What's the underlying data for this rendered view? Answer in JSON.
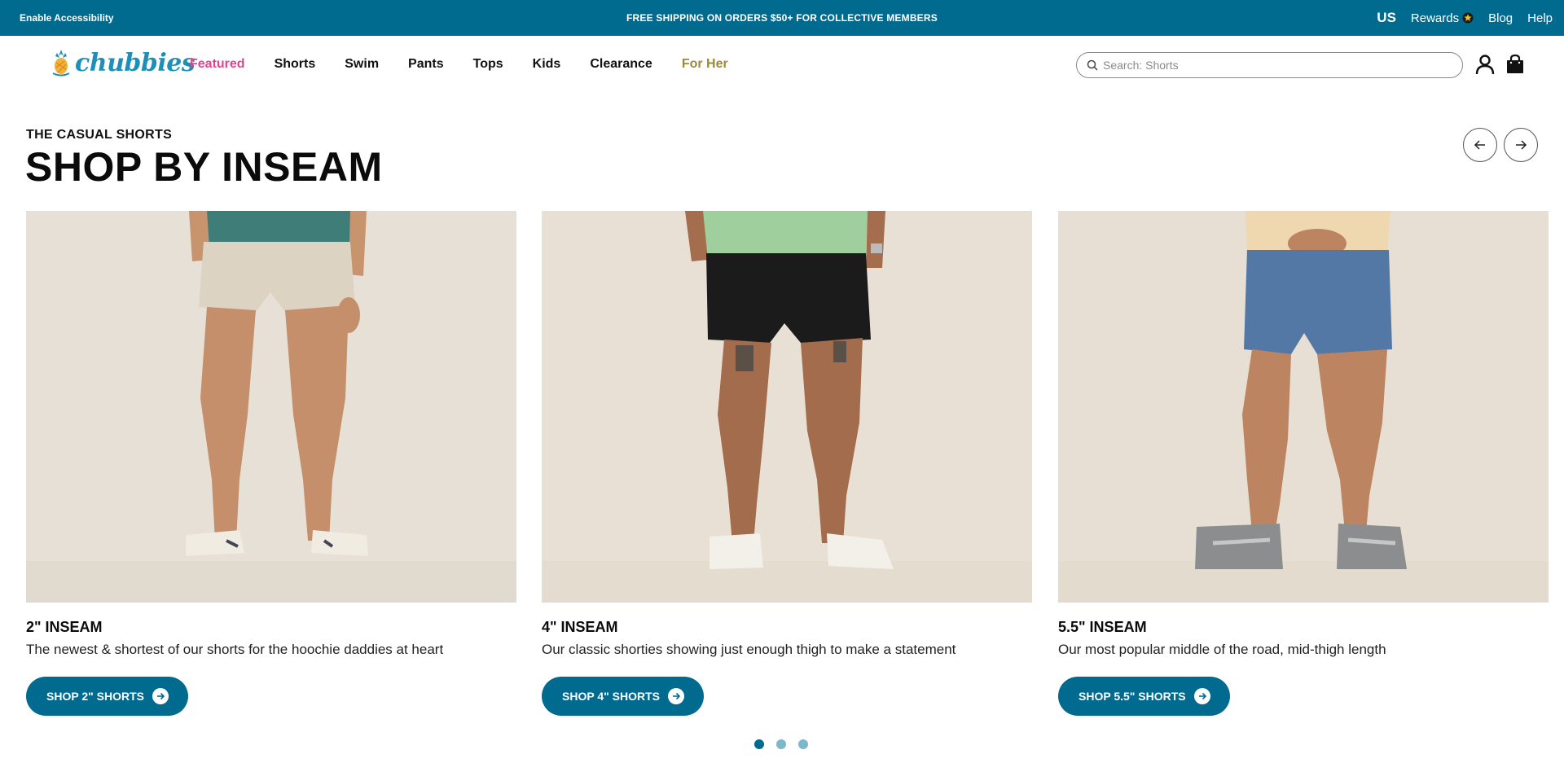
{
  "colors": {
    "brand": "#006b8f",
    "featured": "#e0458c",
    "for_her": "#9a8a3c",
    "logo": "#1d8fb8"
  },
  "topbar": {
    "accessibility": "Enable Accessibility",
    "promo": "FREE SHIPPING ON ORDERS $50+ FOR COLLECTIVE MEMBERS",
    "region": "US",
    "rewards": "Rewards",
    "blog": "Blog",
    "help": "Help"
  },
  "header": {
    "logo": "chubbies",
    "nav": [
      "Featured",
      "Shorts",
      "Swim",
      "Pants",
      "Tops",
      "Kids",
      "Clearance",
      "For Her"
    ],
    "search_placeholder": "Search: Shorts",
    "icons": [
      "search-icon",
      "account-icon",
      "bag-icon"
    ]
  },
  "section": {
    "eyebrow": "THE CASUAL SHORTS",
    "title": "SHOP BY INSEAM"
  },
  "cards": [
    {
      "title": "2\" INSEAM",
      "description": "The newest & shortest of our shorts for the hoochie daddies at heart",
      "button": "SHOP 2\" SHORTS"
    },
    {
      "title": "4\" INSEAM",
      "description": "Our classic shorties showing just enough thigh to make a statement",
      "button": "SHOP 4\" SHORTS"
    },
    {
      "title": "5.5\" INSEAM",
      "description": "Our most popular middle of the road, mid-thigh length",
      "button": "SHOP 5.5\" SHORTS"
    }
  ],
  "carousel": {
    "pages": 3,
    "active_page": 1
  }
}
